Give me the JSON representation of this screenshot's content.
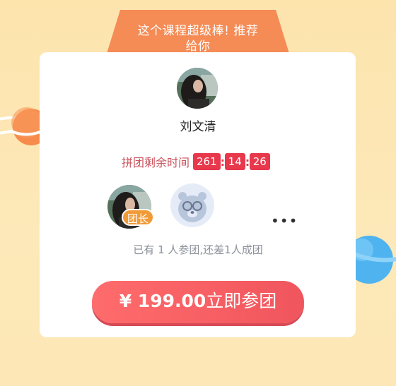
{
  "banner": {
    "line1": "这个课程超级棒! 推荐",
    "line2": "给你"
  },
  "host": {
    "name": "刘文清"
  },
  "countdown": {
    "label": "拼团剩余时间",
    "hours": "261",
    "minutes": "14",
    "seconds": "26",
    "separator": ":"
  },
  "group": {
    "leader_badge": "团长",
    "more": "•••",
    "status": "已有 1 人参团,还差1人成团"
  },
  "action": {
    "price": "¥ 199.00",
    "label": "立即参团"
  },
  "colors": {
    "accent": "#e8384b",
    "banner": "#f58b55",
    "button": "#f0555d",
    "badge": "#f19a38"
  }
}
